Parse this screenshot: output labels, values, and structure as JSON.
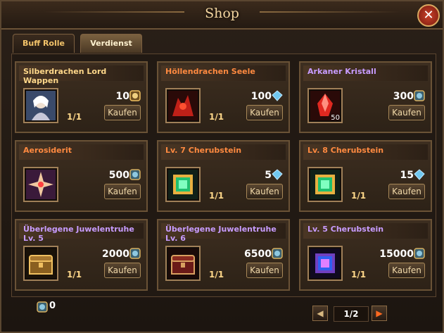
{
  "window": {
    "title": "Shop",
    "close_label": "✕"
  },
  "tabs": [
    {
      "label": "Buff Rolle",
      "active": false
    },
    {
      "label": "Verdienst",
      "active": true
    }
  ],
  "items": [
    {
      "name": "Silberdrachen Lord Wappen",
      "name_color": "gold",
      "price": "10",
      "currency": "gold-badge",
      "stock": "1/1",
      "buy": "Kaufen",
      "icon": "portrait-icon",
      "count": ""
    },
    {
      "name": "Höllendrachen Seele",
      "name_color": "orange",
      "price": "100",
      "currency": "diamond",
      "stock": "1/1",
      "buy": "Kaufen",
      "icon": "red-dragon-icon",
      "count": ""
    },
    {
      "name": "Arkaner Kristall",
      "name_color": "purple",
      "price": "300",
      "currency": "badge",
      "stock": "",
      "buy": "Kaufen",
      "icon": "red-crystal-icon",
      "count": "50"
    },
    {
      "name": "Aerosiderit",
      "name_color": "orange",
      "price": "500",
      "currency": "badge",
      "stock": "",
      "buy": "Kaufen",
      "icon": "star-shard-icon",
      "count": ""
    },
    {
      "name": "Lv. 7 Cherubstein",
      "name_color": "orange",
      "price": "5",
      "currency": "diamond",
      "stock": "1/1",
      "buy": "Kaufen",
      "icon": "green-gem-icon",
      "count": ""
    },
    {
      "name": "Lv. 8 Cherubstein",
      "name_color": "orange",
      "price": "15",
      "currency": "diamond",
      "stock": "1/1",
      "buy": "Kaufen",
      "icon": "green-gem-icon",
      "count": ""
    },
    {
      "name": "Überlegene Juwelentruhe Lv. 5",
      "name_color": "purple",
      "price": "2000",
      "currency": "badge",
      "stock": "1/1",
      "buy": "Kaufen",
      "icon": "gold-chest-icon",
      "count": ""
    },
    {
      "name": "Überlegene Juwelentruhe Lv. 6",
      "name_color": "purple",
      "price": "6500",
      "currency": "badge",
      "stock": "1/1",
      "buy": "Kaufen",
      "icon": "red-chest-icon",
      "count": ""
    },
    {
      "name": "Lv. 5 Cherubstein",
      "name_color": "purple",
      "price": "15000",
      "currency": "badge",
      "stock": "1/1",
      "buy": "Kaufen",
      "icon": "purple-gem-icon",
      "count": ""
    }
  ],
  "footer": {
    "balance": "0",
    "currency": "badge"
  },
  "pager": {
    "label": "1/2",
    "prev": "◀",
    "next": "▶"
  }
}
